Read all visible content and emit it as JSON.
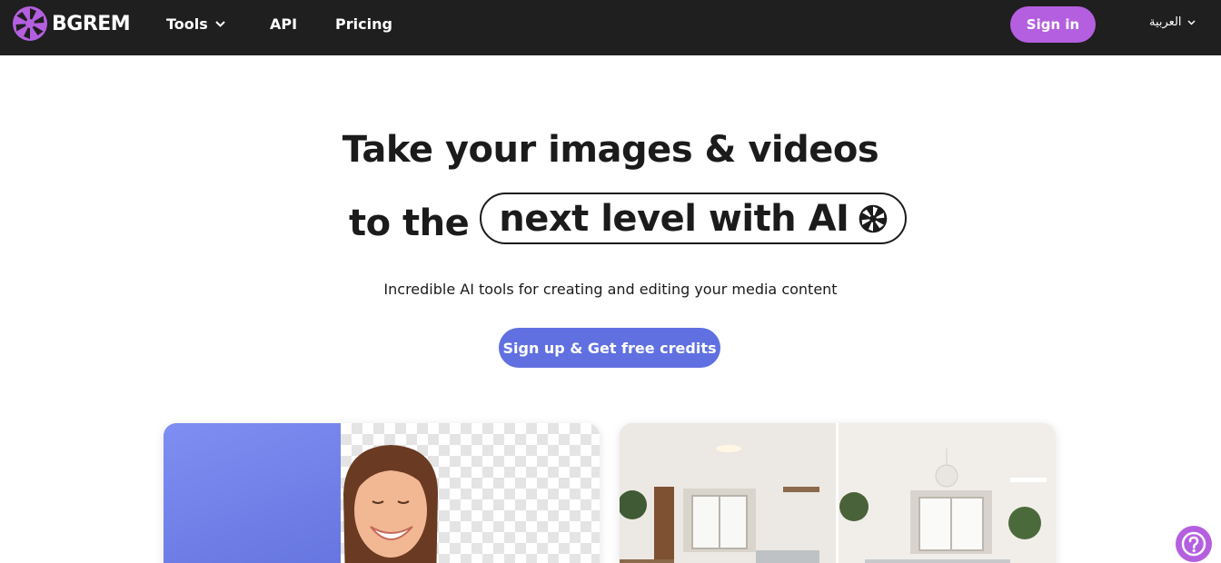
{
  "header": {
    "logo_text": "BGREM",
    "nav": [
      {
        "label": "Tools",
        "has_dropdown": true
      },
      {
        "label": "API"
      },
      {
        "label": "Pricing"
      }
    ],
    "signin_label": "Sign in",
    "language": "العربية"
  },
  "hero": {
    "line1": "Take your images & videos",
    "line2_plain": "to the",
    "line2_highlight": "next level with AI",
    "subtitle": "Incredible AI tools for creating and editing your media content",
    "cta_label": "Sign up & Get free credits"
  },
  "colors": {
    "header_bg": "#1f1f1f",
    "brand_purple": "#b45fe0",
    "cta_blue": "#6170e0"
  },
  "icons": [
    "aperture-logo-icon",
    "chevron-down-icon",
    "aperture-icon",
    "help-question-icon"
  ]
}
